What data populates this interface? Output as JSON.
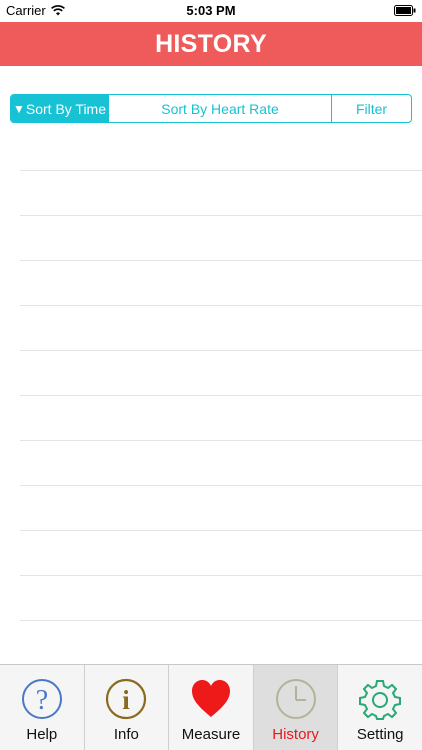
{
  "status_bar": {
    "carrier": "Carrier",
    "time": "5:03 PM"
  },
  "header": {
    "title": "HISTORY",
    "color": "#ef5a5a"
  },
  "sort_control": {
    "accent_color": "#16c2d3",
    "selected_indicator": "▼",
    "options": [
      {
        "label": "Sort By Time",
        "selected": true
      },
      {
        "label": "Sort By Heart Rate",
        "selected": false
      },
      {
        "label": "Filter",
        "selected": false
      }
    ]
  },
  "tabs": [
    {
      "label": "Help",
      "icon": "question-circle-icon",
      "active": false
    },
    {
      "label": "Info",
      "icon": "info-circle-icon",
      "active": false
    },
    {
      "label": "Measure",
      "icon": "heart-icon",
      "active": false
    },
    {
      "label": "History",
      "icon": "clock-icon",
      "active": true
    },
    {
      "label": "Setting",
      "icon": "gear-icon",
      "active": false
    }
  ],
  "active_tab_color": "#e8191f"
}
